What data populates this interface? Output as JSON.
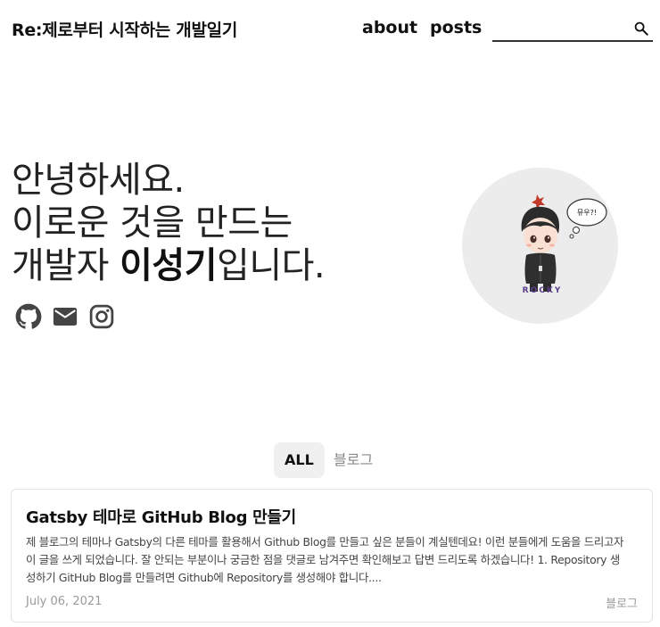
{
  "header": {
    "site_title": "Re:제로부터 시작하는 개발일기",
    "nav": [
      "about",
      "posts"
    ],
    "search": {
      "value": "",
      "placeholder": ""
    }
  },
  "intro": {
    "line1": "안녕하세요.",
    "line2": "이로운 것을 만드는",
    "line3_prefix": "개발자 ",
    "line3_name": "이성기",
    "line3_suffix": "입니다."
  },
  "social_icons": [
    "github-icon",
    "mail-icon",
    "instagram-icon"
  ],
  "avatar": {
    "speech_text": "뮤우?!",
    "signature": "ROCKY"
  },
  "tabs": [
    {
      "label": "ALL",
      "active": true
    },
    {
      "label": "블로그",
      "active": false
    }
  ],
  "posts": [
    {
      "title": "Gatsby 테마로 GitHub Blog 만들기",
      "excerpt": "제 블로그의 테마나 Gatsby의 다른 테마를 활용해서 Github Blog를 만들고 싶은 분들이 계실텐데요! 이런 분들에게 도움을 드리고자 이 글을 쓰게 되었습니다. 잘 안되는 부분이나 궁금한 점을 댓글로 남겨주면 확인해보고 답변 드리도록 하겠습니다! 1. Repository 생성하기 GitHub Blog를 만들려면 Github에 Repository를 생성해야 합니다....",
      "date": "July 06, 2021",
      "category": "블로그"
    }
  ],
  "colors": {
    "text": "#111111",
    "muted": "#9a9a9a",
    "tab_active_bg": "#f0f0f0",
    "avatar_bg": "#ececec"
  }
}
